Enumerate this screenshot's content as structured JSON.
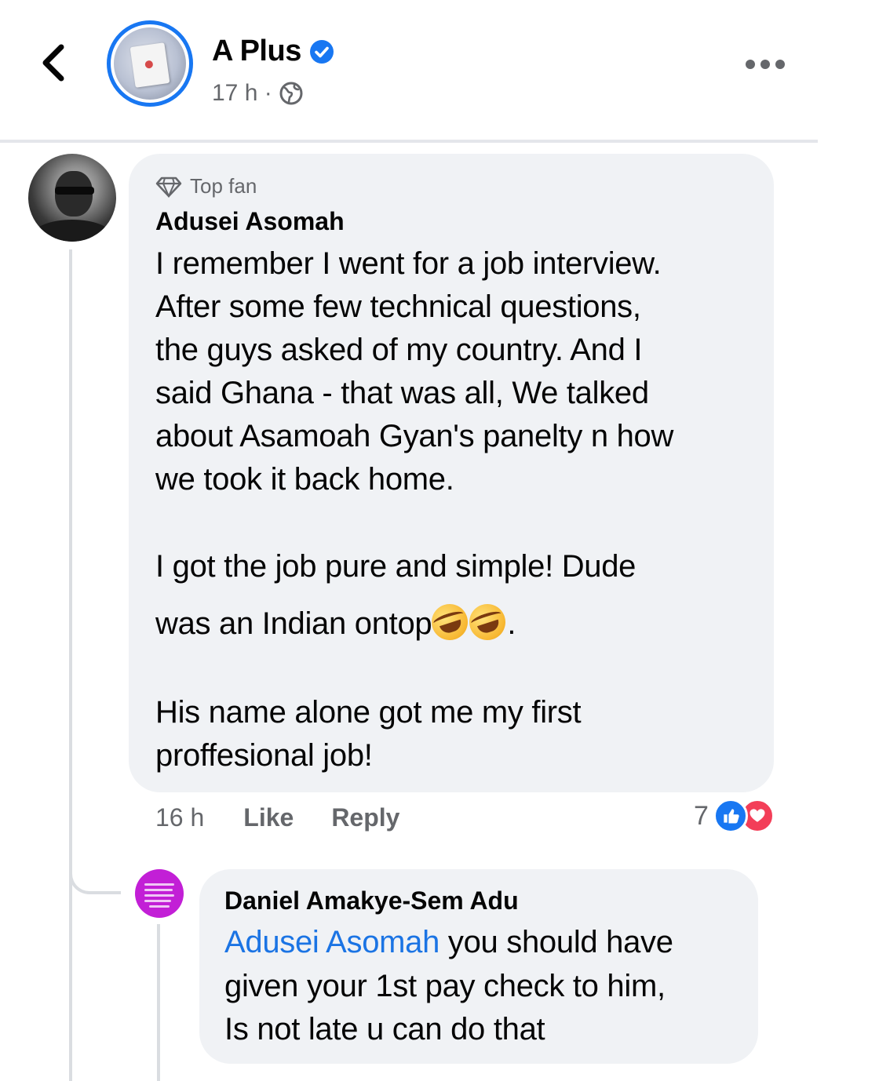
{
  "header": {
    "page_name": "A Plus",
    "time": "17 h ·"
  },
  "comment": {
    "badge": "Top fan",
    "author": "Adusei Asomah",
    "lines": [
      "I remember I went for a job interview.",
      "After some few technical questions,",
      "the guys asked of my country. And I",
      "said Ghana - that was all,  We talked",
      "about Asamoah Gyan's panelty n how",
      "we took it back home.",
      "I got the job pure and simple! Dude",
      "was an Indian ontop",
      ".",
      "His name alone got me my first",
      "proffesional job!"
    ],
    "emoji": [
      "rolling-on-floor-laughing-emoji",
      "rolling-on-floor-laughing-emoji"
    ],
    "time": "16 h",
    "like_label": "Like",
    "reply_label": "Reply",
    "reaction_count": "7"
  },
  "reply": {
    "author": "Daniel Amakye-Sem Adu",
    "mention": "Adusei Asomah",
    "line1_rest": " you should have",
    "line2": "given your 1st pay check to him,",
    "line3": "Is not late u can do that"
  },
  "colors": {
    "accent": "#1877f2",
    "mention": "#1b74e4",
    "bubble": "#f0f2f5",
    "secondary_text": "#65676b",
    "love": "#f33e58"
  }
}
